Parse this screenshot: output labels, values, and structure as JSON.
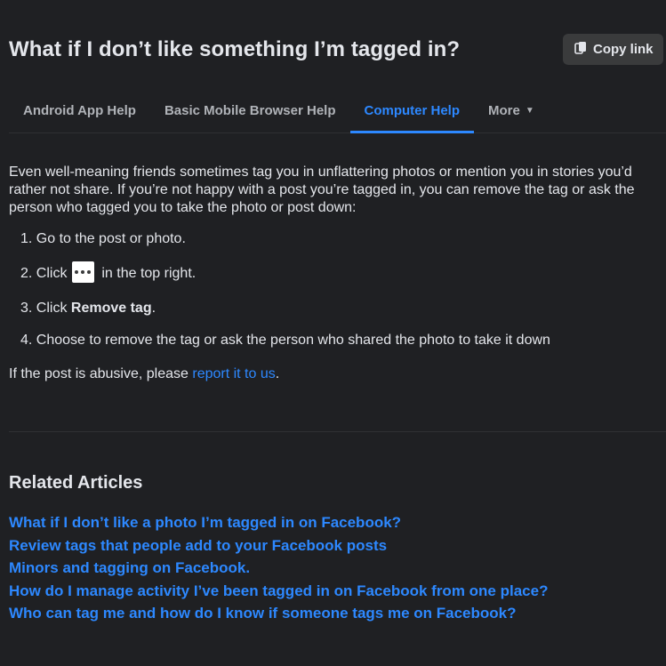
{
  "header": {
    "title": "What if I don’t like something I’m tagged in?",
    "copy_link_label": "Copy link"
  },
  "tabs": [
    {
      "label": "Android App Help",
      "active": false
    },
    {
      "label": "Basic Mobile Browser Help",
      "active": false
    },
    {
      "label": "Computer Help",
      "active": true
    },
    {
      "label": "More",
      "active": false
    }
  ],
  "article": {
    "intro": "Even well-meaning friends sometimes tag you in unflattering photos or mention you in stories you’d rather not share. If you’re not happy with a post you’re tagged in, you can remove the tag or ask the person who tagged you to take the photo or post down:",
    "steps": {
      "s1": "1. Go to the post or photo.",
      "s2_before": "2. Click",
      "s2_after": "in the top right.",
      "s3_before": "3. Click",
      "s3_bold": "Remove tag",
      "s3_after": ".",
      "s4": "4. Choose to remove the tag or ask the person who shared the photo to take it down"
    },
    "abuse_before": "If the post is abusive, please",
    "abuse_link": "report it to us",
    "abuse_after": "."
  },
  "related": {
    "heading": "Related Articles",
    "items": [
      "What if I don’t like a photo I’m tagged in on Facebook?",
      "Review tags that people add to your Facebook posts",
      "Minors and tagging on Facebook.",
      "How do I manage activity I’ve been tagged in on Facebook from one place?",
      "Who can tag me and how do I know if someone tags me on Facebook?"
    ]
  },
  "colors": {
    "background": "#1f2023",
    "accent": "#2d88ff",
    "text": "#e4e6eb",
    "muted": "#b0b3b8"
  }
}
